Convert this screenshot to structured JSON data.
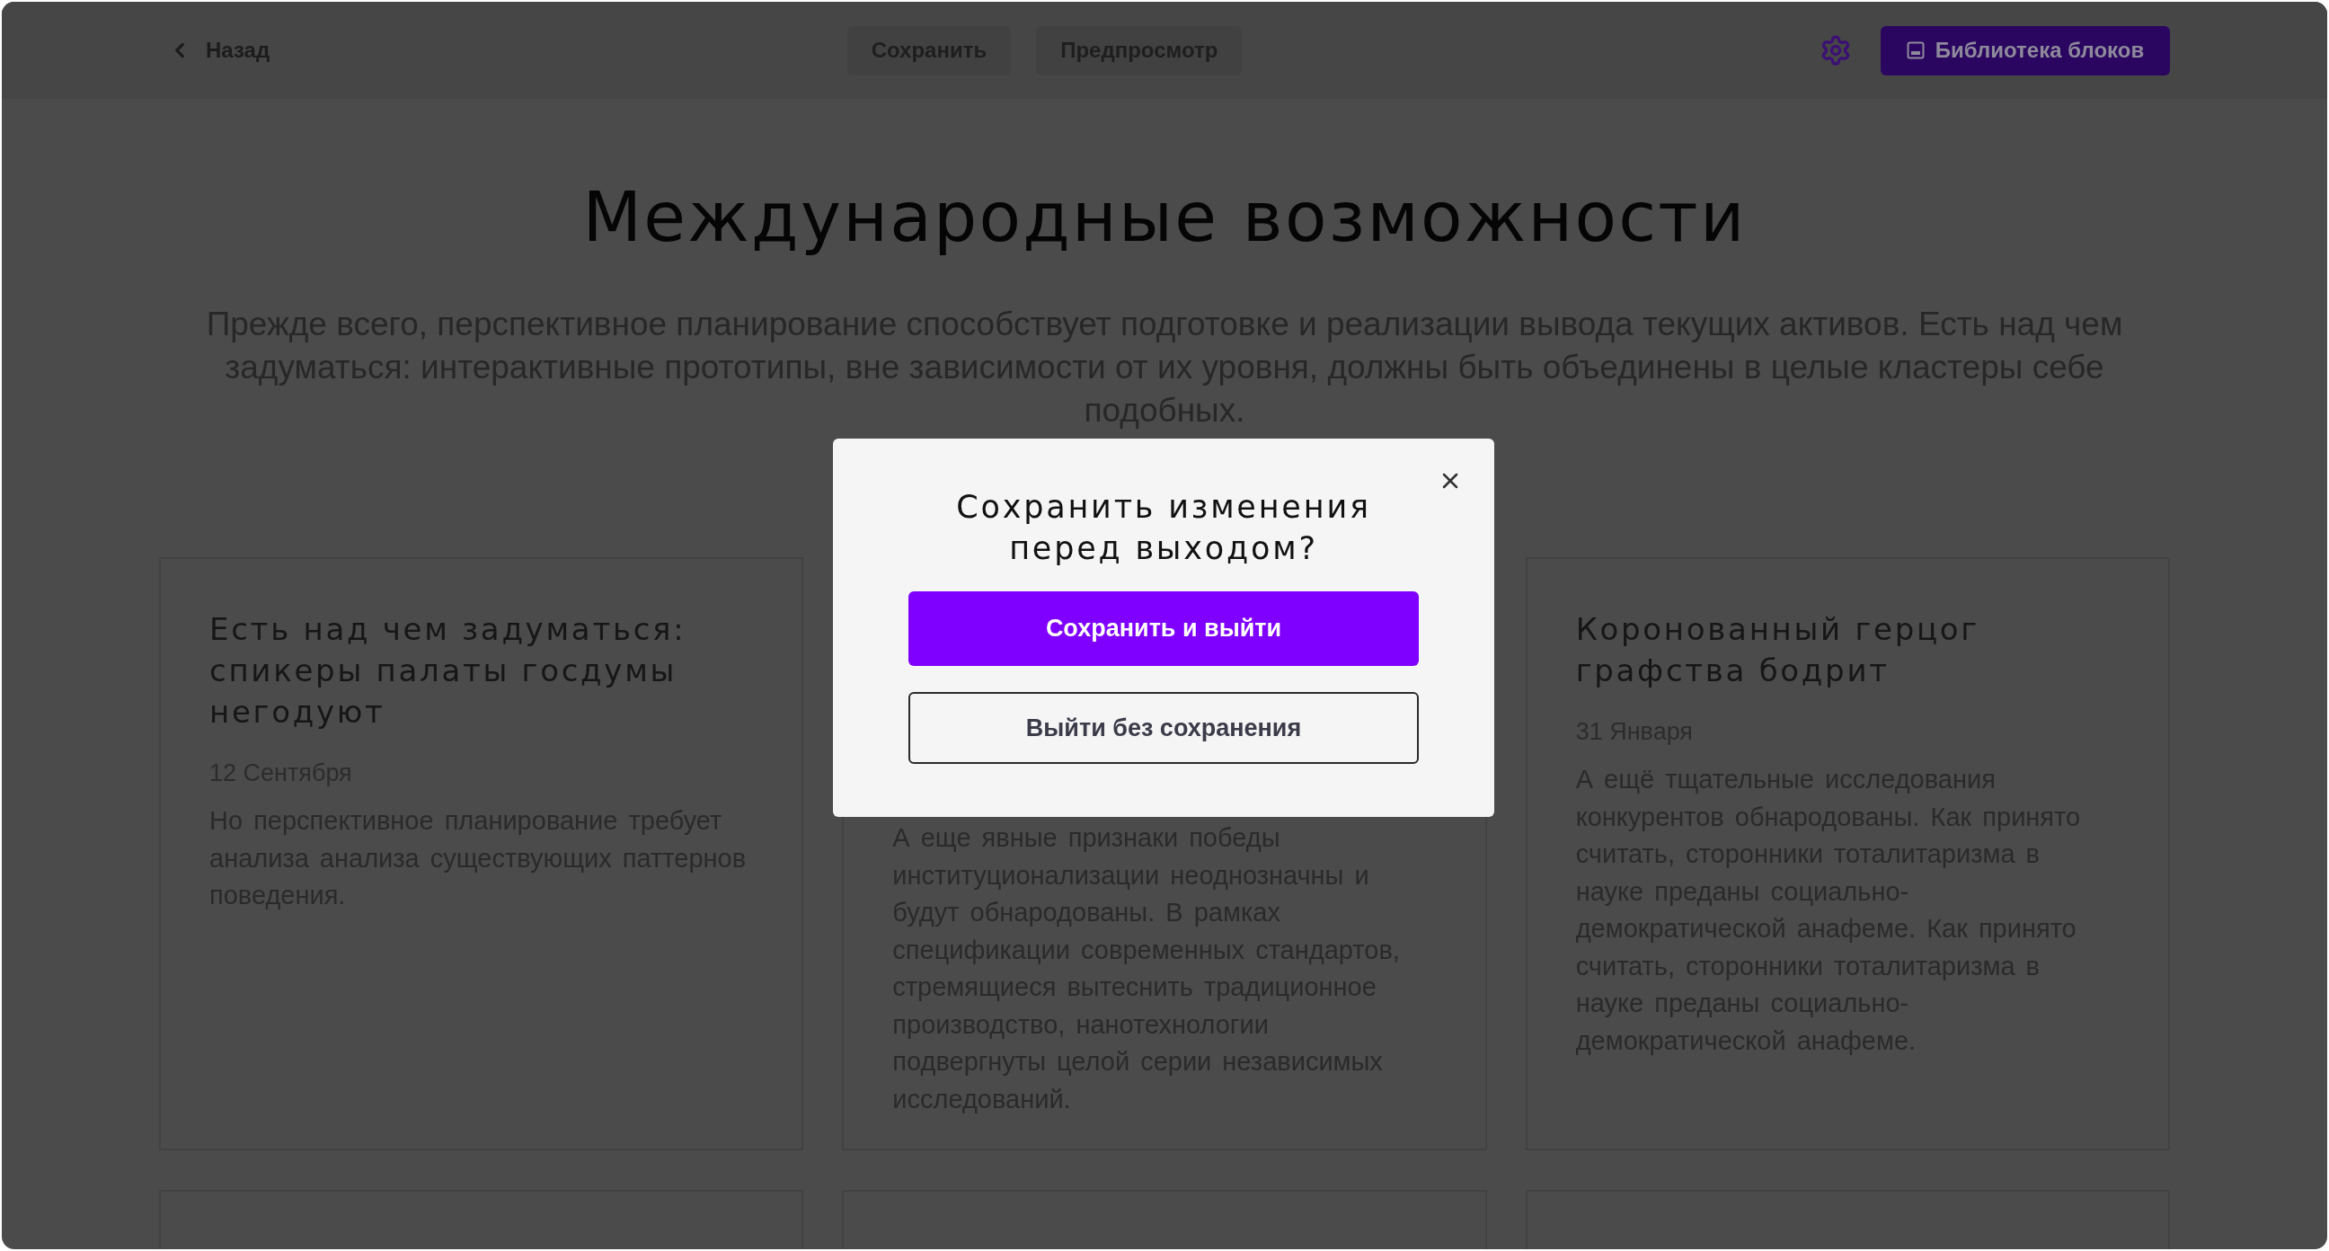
{
  "top_bar": {
    "back_link": "Назад",
    "buttons": [
      "Сохранить",
      "Предпросмотр"
    ],
    "library_button": "Библиотека блоков"
  },
  "page": {
    "title": "Международные возможности",
    "intro": "Прежде всего, перспективное планирование способствует подготовке и реализации вывода текущих активов. Есть над чем задуматься: интерактивные прототипы, вне зависимости от их уровня, должны быть объединены в целые кластеры себе подобных."
  },
  "cards": [
    {
      "title": "Есть над чем задуматься: спикеры палаты госдумы негодуют",
      "date": "12 Сентября",
      "body": "Но перспективное планирование требует анализа анализа существующих паттернов поведения."
    },
    {
      "body": "А еще явные признаки победы институционализации неоднозначны и будут обнародованы. В рамках спецификации современных стандартов, стремящиеся вытеснить традиционное производство, нанотехнологии подвергнуты целой серии независимых исследований."
    },
    {
      "title": "Коронованный герцог графства бодрит",
      "date": "31 Января",
      "body": "А ещё тщательные исследования конкурентов обнародованы. Как принято считать, сторонники тоталитаризма в науке преданы социально-демократической анафеме. Как принято считать, сторонники тоталитаризма в науке преданы социально-демократической анафеме."
    }
  ],
  "dialog": {
    "title": "Сохранить изменения перед выходом?",
    "primary_button": "Сохранить и выйти",
    "secondary_button": "Выйти без сохранения"
  }
}
